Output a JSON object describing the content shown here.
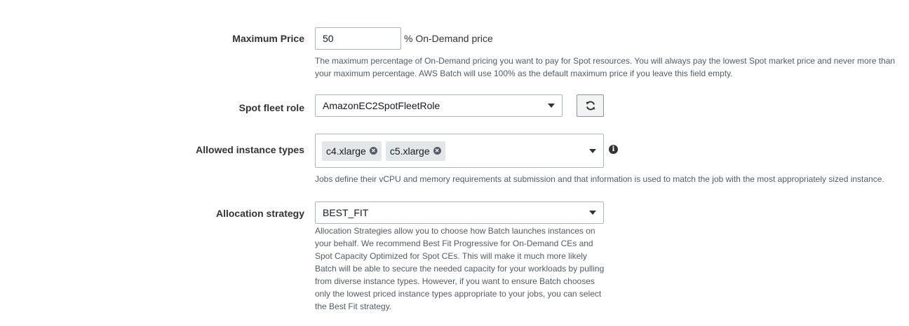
{
  "max_price": {
    "label": "Maximum Price",
    "value": "50",
    "suffix": "% On-Demand price",
    "help_line1": "The maximum percentage of On-Demand pricing you want to pay for Spot resources. You will always pay the lowest Spot market price and never more than",
    "help_line2": "your maximum percentage. AWS Batch will use 100% as the default maximum price if you leave this field empty."
  },
  "spot_fleet_role": {
    "label": "Spot fleet role",
    "value": "AmazonEC2SpotFleetRole",
    "refresh_icon": "refresh-icon"
  },
  "allowed_instance_types": {
    "label": "Allowed instance types",
    "tokens": [
      "c4.xlarge",
      "c5.xlarge"
    ],
    "info_icon": "info-icon",
    "help": "Jobs define their vCPU and memory requirements at submission and that information is used to match the job with the most appropriately sized instance."
  },
  "allocation_strategy": {
    "label": "Allocation strategy",
    "value": "BEST_FIT",
    "help_lines": [
      "Allocation Strategies allow you to choose how Batch launches instances on",
      "your behalf. We recommend Best Fit Progressive for On-Demand CEs and",
      "Spot Capacity Optimized for Spot CEs. This will make it much more likely",
      "Batch will be able to secure the needed capacity for your workloads by pulling",
      "from diverse instance types. However, if you want to ensure Batch chooses",
      "only the lowest priced instance types appropriate to your jobs, you can select",
      "the Best Fit strategy."
    ]
  }
}
